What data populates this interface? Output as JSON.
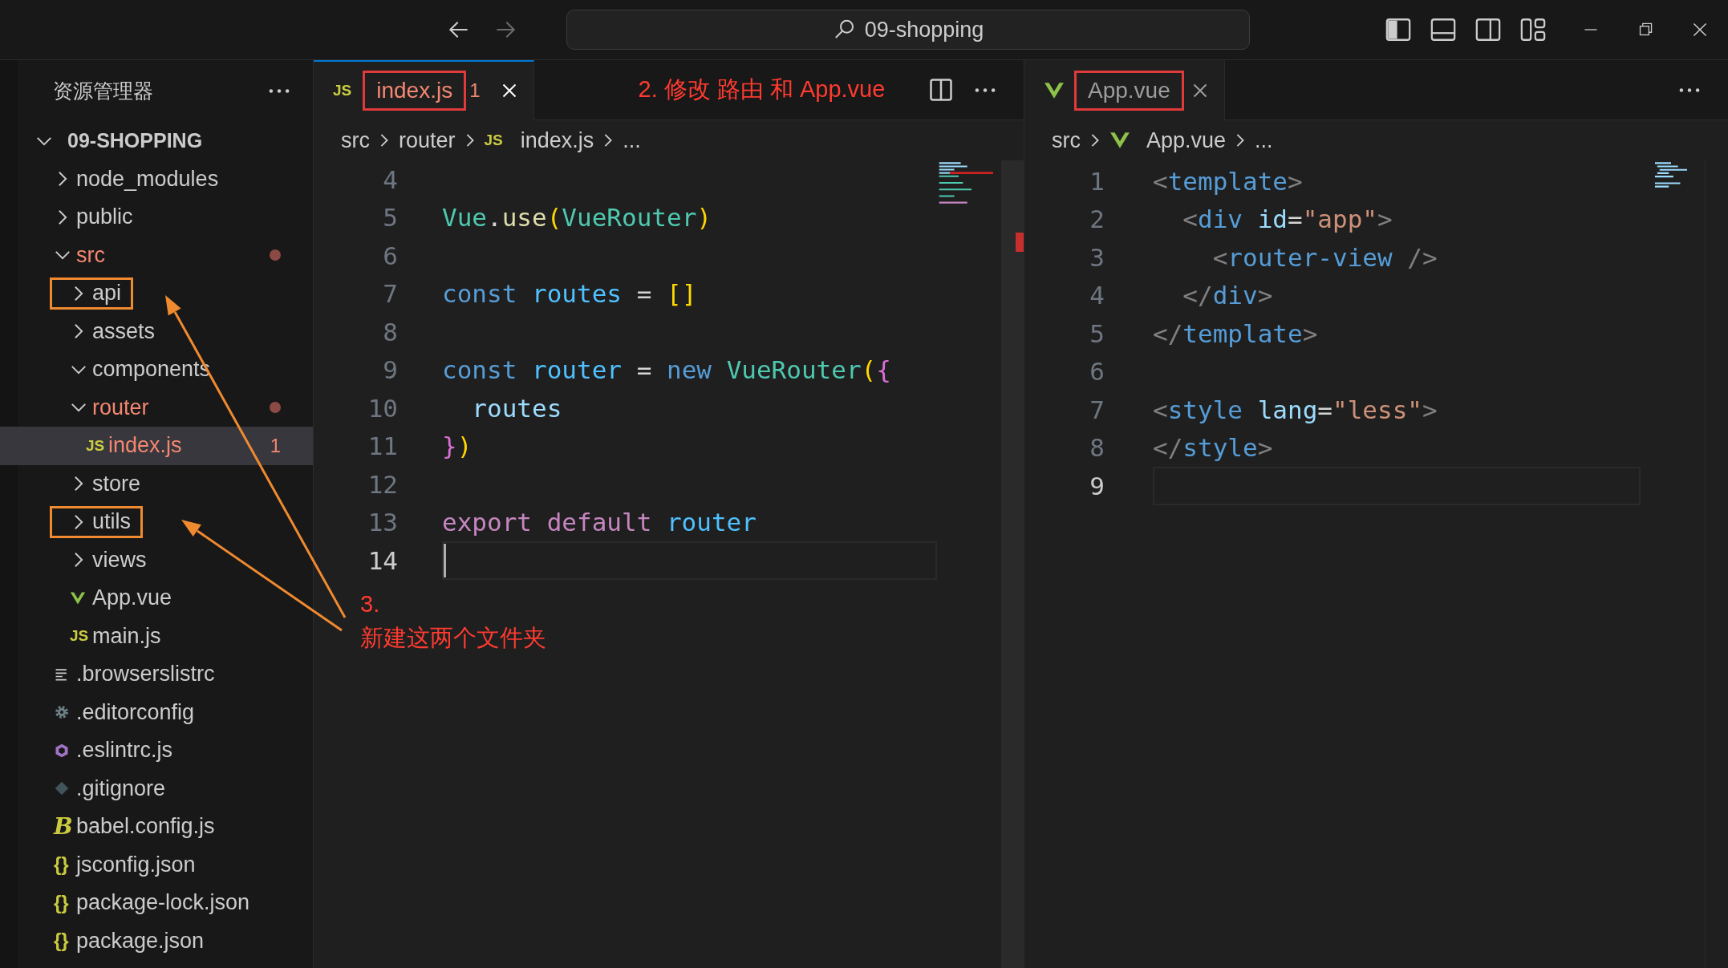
{
  "titlebar": {
    "search": "09-shopping"
  },
  "explorer": {
    "title": "资源管理器",
    "root": {
      "label": "09-SHOPPING",
      "expanded": true
    },
    "items": [
      {
        "kind": "folder",
        "label": "node_modules",
        "expanded": false,
        "modified": false,
        "selected": false,
        "highlighted": false
      },
      {
        "kind": "folder",
        "label": "public",
        "expanded": false,
        "modified": false,
        "selected": false,
        "highlighted": false
      },
      {
        "kind": "folder",
        "label": "src",
        "expanded": true,
        "modified": true,
        "selected": false,
        "highlighted": false,
        "children": [
          {
            "kind": "folder",
            "label": "api",
            "expanded": false,
            "modified": false,
            "selected": false,
            "highlighted": true
          },
          {
            "kind": "folder",
            "label": "assets",
            "expanded": false,
            "modified": false,
            "selected": false,
            "highlighted": false
          },
          {
            "kind": "folder",
            "label": "components",
            "expanded": true,
            "modified": false,
            "selected": false,
            "highlighted": false
          },
          {
            "kind": "folder",
            "label": "router",
            "expanded": true,
            "modified": true,
            "selected": false,
            "highlighted": false,
            "children": [
              {
                "kind": "file",
                "label": "index.js",
                "icon": {
                  "kind": "js",
                  "text": "JS"
                },
                "badge": "1",
                "modified": true,
                "selected": true,
                "highlighted": false
              }
            ]
          },
          {
            "kind": "folder",
            "label": "store",
            "expanded": false,
            "modified": false,
            "selected": false,
            "highlighted": false
          },
          {
            "kind": "folder",
            "label": "utils",
            "expanded": false,
            "modified": false,
            "selected": false,
            "highlighted": true
          },
          {
            "kind": "folder",
            "label": "views",
            "expanded": false,
            "modified": false,
            "selected": false,
            "highlighted": false
          },
          {
            "kind": "file",
            "label": "App.vue",
            "icon": {
              "kind": "vue"
            },
            "modified": false,
            "selected": false,
            "highlighted": false
          },
          {
            "kind": "file",
            "label": "main.js",
            "icon": {
              "kind": "js",
              "text": "JS"
            },
            "modified": false,
            "selected": false,
            "highlighted": false
          }
        ]
      },
      {
        "kind": "file",
        "label": ".browserslistrc",
        "icon": {
          "kind": "lines"
        },
        "modified": false,
        "selected": false,
        "highlighted": false
      },
      {
        "kind": "file",
        "label": ".editorconfig",
        "icon": {
          "kind": "gear"
        },
        "modified": false,
        "selected": false,
        "highlighted": false
      },
      {
        "kind": "file",
        "label": ".eslintrc.js",
        "icon": {
          "kind": "hexagon"
        },
        "modified": false,
        "selected": false,
        "highlighted": false
      },
      {
        "kind": "file",
        "label": ".gitignore",
        "icon": {
          "kind": "git"
        },
        "modified": false,
        "selected": false,
        "highlighted": false
      },
      {
        "kind": "file",
        "label": "babel.config.js",
        "icon": {
          "kind": "babel",
          "text": "B"
        },
        "modified": false,
        "selected": false,
        "highlighted": false
      },
      {
        "kind": "file",
        "label": "jsconfig.json",
        "icon": {
          "kind": "braces",
          "text": "{}"
        },
        "modified": false,
        "selected": false,
        "highlighted": false
      },
      {
        "kind": "file",
        "label": "package-lock.json",
        "icon": {
          "kind": "braces",
          "text": "{}"
        },
        "modified": false,
        "selected": false,
        "highlighted": false
      },
      {
        "kind": "file",
        "label": "package.json",
        "icon": {
          "kind": "braces",
          "text": "{}"
        },
        "modified": false,
        "selected": false,
        "highlighted": false
      }
    ]
  },
  "editors": [
    {
      "focused": true,
      "tabs": [
        {
          "label": "index.js",
          "icon": {
            "kind": "js",
            "text": "JS"
          },
          "badge": "1",
          "error": true,
          "selected": true,
          "highlighted": true
        }
      ],
      "note": "2. 修改 路由 和 App.vue",
      "breadcrumb": [
        {
          "label": "src"
        },
        {
          "label": "router"
        },
        {
          "label": "index.js",
          "icon": {
            "kind": "js",
            "text": "JS"
          }
        },
        {
          "label": "..."
        }
      ],
      "lines": [
        {
          "n": "4",
          "current": false
        },
        {
          "n": "5",
          "current": false,
          "tokens": [
            {
              "text": "Vue",
              "color": "#4ec9b0"
            },
            {
              "text": ".",
              "color": "#d4d4d4"
            },
            {
              "text": "use",
              "color": "#dcdcaa"
            },
            {
              "text": "(",
              "color": "#ffd700"
            },
            {
              "text": "VueRouter",
              "color": "#4ec9b0"
            },
            {
              "text": ")",
              "color": "#ffd700"
            }
          ]
        },
        {
          "n": "6",
          "current": false
        },
        {
          "n": "7",
          "current": false,
          "tokens": [
            {
              "text": "const",
              "color": "#569cd6"
            },
            {
              "text": " routes",
              "color": "#4fc1ff"
            },
            {
              "text": " =",
              "color": "#d4d4d4"
            },
            {
              "text": " []",
              "color": "#ffd700"
            }
          ]
        },
        {
          "n": "8",
          "current": false
        },
        {
          "n": "9",
          "current": false,
          "tokens": [
            {
              "text": "const",
              "color": "#569cd6"
            },
            {
              "text": " router",
              "color": "#4fc1ff"
            },
            {
              "text": " =",
              "color": "#d4d4d4"
            },
            {
              "text": " new",
              "color": "#569cd6"
            },
            {
              "text": " VueRouter",
              "color": "#4ec9b0"
            },
            {
              "text": "(",
              "color": "#ffd700"
            },
            {
              "text": "{",
              "color": "#da70d6"
            }
          ]
        },
        {
          "n": "10",
          "current": false,
          "tokens": [
            {
              "text": "  routes",
              "color": "#9cdcfe"
            }
          ]
        },
        {
          "n": "11",
          "current": false,
          "tokens": [
            {
              "text": "}",
              "color": "#da70d6"
            },
            {
              "text": ")",
              "color": "#ffd700"
            }
          ]
        },
        {
          "n": "12",
          "current": false
        },
        {
          "n": "13",
          "current": false,
          "tokens": [
            {
              "text": "export",
              "color": "#c586c0"
            },
            {
              "text": " default",
              "color": "#c586c0"
            },
            {
              "text": " router",
              "color": "#4fc1ff"
            }
          ]
        },
        {
          "n": "14",
          "current": true
        }
      ]
    },
    {
      "focused": false,
      "tabs": [
        {
          "label": "App.vue",
          "icon": {
            "kind": "vue"
          },
          "error": false,
          "selected": true,
          "highlighted": true
        }
      ],
      "breadcrumb": [
        {
          "label": "src"
        },
        {
          "label": "App.vue",
          "icon": {
            "kind": "vue"
          }
        },
        {
          "label": "..."
        }
      ],
      "lines": [
        {
          "n": "1",
          "current": false,
          "tokens": [
            {
              "text": "<",
              "color": "#808080"
            },
            {
              "text": "template",
              "color": "#569cd6"
            },
            {
              "text": ">",
              "color": "#808080"
            }
          ]
        },
        {
          "n": "2",
          "current": false,
          "tokens": [
            {
              "text": "  <",
              "color": "#808080"
            },
            {
              "text": "div",
              "color": "#569cd6"
            },
            {
              "text": " id",
              "color": "#9cdcfe"
            },
            {
              "text": "=",
              "color": "#d4d4d4"
            },
            {
              "text": "\"app\"",
              "color": "#ce9178"
            },
            {
              "text": ">",
              "color": "#808080"
            }
          ]
        },
        {
          "n": "3",
          "current": false,
          "tokens": [
            {
              "text": "    <",
              "color": "#808080"
            },
            {
              "text": "router-view",
              "color": "#569cd6"
            },
            {
              "text": " />",
              "color": "#808080"
            }
          ]
        },
        {
          "n": "4",
          "current": false,
          "tokens": [
            {
              "text": "  </",
              "color": "#808080"
            },
            {
              "text": "div",
              "color": "#569cd6"
            },
            {
              "text": ">",
              "color": "#808080"
            }
          ]
        },
        {
          "n": "5",
          "current": false,
          "tokens": [
            {
              "text": "</",
              "color": "#808080"
            },
            {
              "text": "template",
              "color": "#569cd6"
            },
            {
              "text": ">",
              "color": "#808080"
            }
          ]
        },
        {
          "n": "6",
          "current": false
        },
        {
          "n": "7",
          "current": false,
          "tokens": [
            {
              "text": "<",
              "color": "#808080"
            },
            {
              "text": "style",
              "color": "#569cd6"
            },
            {
              "text": " lang",
              "color": "#9cdcfe"
            },
            {
              "text": "=",
              "color": "#d4d4d4"
            },
            {
              "text": "\"less\"",
              "color": "#ce9178"
            },
            {
              "text": ">",
              "color": "#808080"
            }
          ]
        },
        {
          "n": "8",
          "current": false,
          "tokens": [
            {
              "text": "</",
              "color": "#808080"
            },
            {
              "text": "style",
              "color": "#569cd6"
            },
            {
              "text": ">",
              "color": "#808080"
            }
          ]
        },
        {
          "n": "9",
          "current": true
        }
      ]
    }
  ],
  "annotations": {
    "lines": [
      "3.",
      "新建这两个文件夹"
    ]
  }
}
